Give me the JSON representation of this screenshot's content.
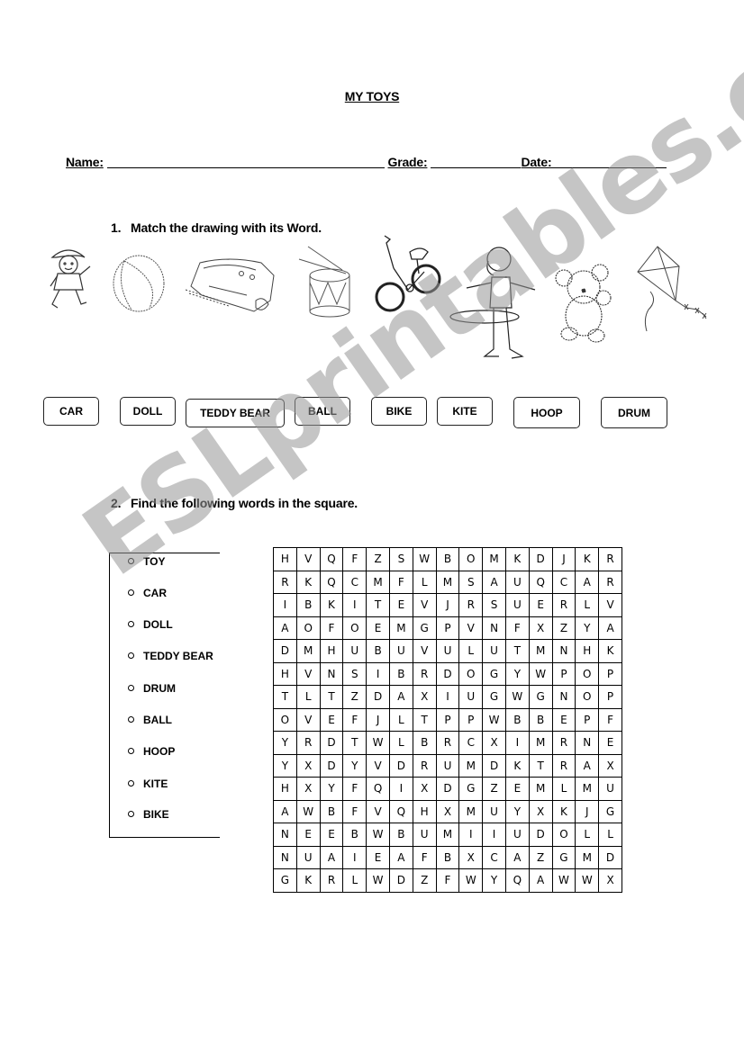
{
  "worksheet": {
    "title": "MY TOYS",
    "info_fields": [
      {
        "label": "Name:"
      },
      {
        "label": "Grade:"
      },
      {
        "label": "Date:"
      }
    ]
  },
  "section1": {
    "number": "1.",
    "instruction": "Match the drawing with its Word.",
    "drawings": [
      "doll",
      "ball",
      "car",
      "drum",
      "bike",
      "hoop",
      "teddy bear",
      "kite"
    ],
    "word_boxes": [
      "CAR",
      "DOLL",
      "TEDDY BEAR",
      "BALL",
      "BIKE",
      "KITE",
      "HOOP",
      "DRUM"
    ]
  },
  "section2": {
    "number": "2.",
    "instruction": "Find the following words in the square.",
    "word_list": [
      "TOY",
      "CAR",
      "DOLL",
      "TEDDY BEAR",
      "DRUM",
      "BALL",
      "HOOP",
      "KITE",
      "BIKE"
    ],
    "grid": [
      [
        "H",
        "V",
        "Q",
        "F",
        "Z",
        "S",
        "W",
        "B",
        "O",
        "M",
        "K",
        "D",
        "J",
        "K",
        "R"
      ],
      [
        "R",
        "K",
        "Q",
        "C",
        "M",
        "F",
        "L",
        "M",
        "S",
        "A",
        "U",
        "Q",
        "C",
        "A",
        "R"
      ],
      [
        "I",
        "B",
        "K",
        "I",
        "T",
        "E",
        "V",
        "J",
        "R",
        "S",
        "U",
        "E",
        "R",
        "L",
        "V"
      ],
      [
        "A",
        "O",
        "F",
        "O",
        "E",
        "M",
        "G",
        "P",
        "V",
        "N",
        "F",
        "X",
        "Z",
        "Y",
        "A"
      ],
      [
        "D",
        "M",
        "H",
        "U",
        "B",
        "U",
        "V",
        "U",
        "L",
        "U",
        "T",
        "M",
        "N",
        "H",
        "K"
      ],
      [
        "H",
        "V",
        "N",
        "S",
        "I",
        "B",
        "R",
        "D",
        "O",
        "G",
        "Y",
        "W",
        "P",
        "O",
        "P"
      ],
      [
        "T",
        "L",
        "T",
        "Z",
        "D",
        "A",
        "X",
        "I",
        "U",
        "G",
        "W",
        "G",
        "N",
        "O",
        "P"
      ],
      [
        "O",
        "V",
        "E",
        "F",
        "J",
        "L",
        "T",
        "P",
        "P",
        "W",
        "B",
        "B",
        "E",
        "P",
        "F"
      ],
      [
        "Y",
        "R",
        "D",
        "T",
        "W",
        "L",
        "B",
        "R",
        "C",
        "X",
        "I",
        "M",
        "R",
        "N",
        "E"
      ],
      [
        "Y",
        "X",
        "D",
        "Y",
        "V",
        "D",
        "R",
        "U",
        "M",
        "D",
        "K",
        "T",
        "R",
        "A",
        "X"
      ],
      [
        "H",
        "X",
        "Y",
        "F",
        "Q",
        "I",
        "X",
        "D",
        "G",
        "Z",
        "E",
        "M",
        "L",
        "M",
        "U"
      ],
      [
        "A",
        "W",
        "B",
        "F",
        "V",
        "Q",
        "H",
        "X",
        "M",
        "U",
        "Y",
        "X",
        "K",
        "J",
        "G"
      ],
      [
        "N",
        "E",
        "E",
        "B",
        "W",
        "B",
        "U",
        "M",
        "I",
        "I",
        "U",
        "D",
        "O",
        "L",
        "L"
      ],
      [
        "N",
        "U",
        "A",
        "I",
        "E",
        "A",
        "F",
        "B",
        "X",
        "C",
        "A",
        "Z",
        "G",
        "M",
        "D"
      ],
      [
        "G",
        "K",
        "R",
        "L",
        "W",
        "D",
        "Z",
        "F",
        "W",
        "Y",
        "Q",
        "A",
        "W",
        "W",
        "X"
      ]
    ]
  },
  "watermark": "ESLprintables.com"
}
